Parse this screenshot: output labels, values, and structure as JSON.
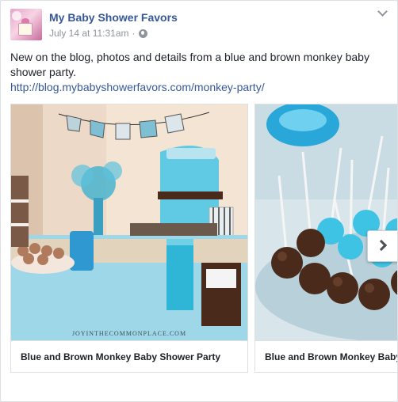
{
  "post": {
    "page_name": "My Baby Shower Favors",
    "timestamp": "July 14 at 11:31am",
    "separator": "·",
    "privacy_icon": "globe-icon",
    "options_icon": "chevron-down-icon",
    "message": "New on the blog, photos and details from a blue and brown monkey baby shower party.",
    "link": "http://blog.mybabyshowerfavors.com/monkey-party/"
  },
  "carousel": {
    "cards": [
      {
        "title": "Blue and Brown Monkey Baby Shower Party",
        "watermark": "JOYINTHECOMMONPLACE.COM"
      },
      {
        "title": "Blue and Brown Monkey Baby Shower Party"
      }
    ],
    "next_icon": "chevron-right-icon"
  },
  "colors": {
    "link": "#365899",
    "meta_text": "#90949c",
    "accent_blue": "#2fb6d6",
    "chocolate": "#4a2a1b"
  }
}
